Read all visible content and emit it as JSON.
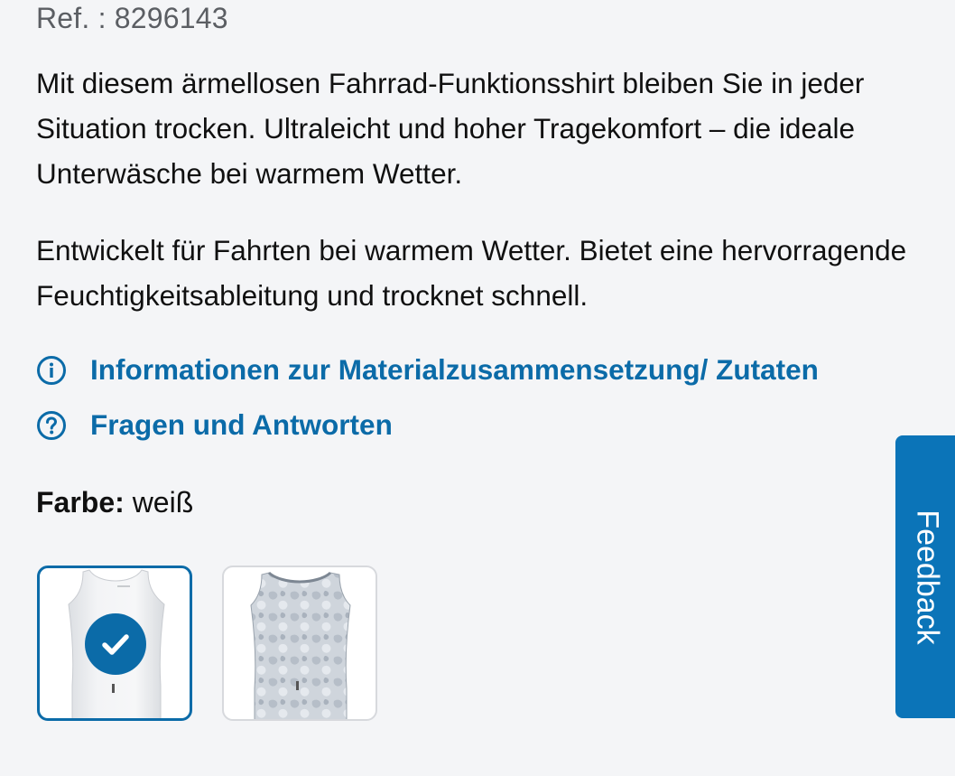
{
  "product": {
    "ref_label": "Ref. : 8296143",
    "description_1": "Mit diesem ärmellosen Fahrrad-Funktionsshirt bleiben Sie in jeder Situation trocken. Ultraleicht und hoher Tragekomfort – die ideale Unterwäsche bei warmem Wetter.",
    "description_2": "Entwickelt für Fahrten bei warmem Wetter. Bietet eine hervorragende Feuchtigkeitsableitung und trocknet schnell."
  },
  "links": {
    "materials": {
      "label": "Informationen zur Materialzusammensetzung/ Zutaten",
      "icon": "info-icon"
    },
    "faq": {
      "label": "Fragen und Antworten",
      "icon": "question-icon"
    }
  },
  "color": {
    "label": "Farbe:",
    "value": "weiß",
    "swatches": [
      {
        "name": "white-sleeveless-shirt",
        "selected": true
      },
      {
        "name": "grey-camo-sleeveless-shirt",
        "selected": false
      }
    ]
  },
  "feedback": {
    "label": "Feedback"
  },
  "colors": {
    "accent": "#0b6ba8",
    "feedback_bg": "#0b74b8",
    "background": "#f4f5f7"
  }
}
